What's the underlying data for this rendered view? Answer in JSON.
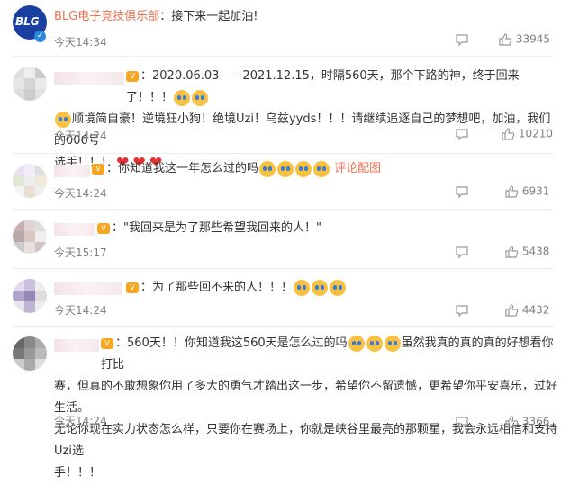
{
  "comments": [
    {
      "name": "BLG电子竞技俱乐部",
      "text": "：接下来一起加油!",
      "time": "今天14:34",
      "likes": "33945"
    },
    {
      "line1": "：2020.06.03——2021.12.15，时隔560天，那个下路的神，终于回来了！！！",
      "line2": "顺境简自豪！逆境狂小狗！绝境Uzi！乌兹yyds！！！请继续追逐自己的梦想吧，加油，我们的006号",
      "line3": "选手！！！",
      "time": "今天14:24",
      "likes": "10210"
    },
    {
      "text": "：你知道我这一年怎么过的吗",
      "link": "评论配图",
      "time": "今天14:24",
      "likes": "6931"
    },
    {
      "text": "：\"我回来是为了那些希望我回来的人！\"",
      "time": "今天15:17",
      "likes": "5438"
    },
    {
      "text": "：为了那些回不来的人！！！",
      "time": "今天14:24",
      "likes": "4432"
    },
    {
      "line1a": "：560天！！你知道我这560天是怎么过的吗",
      "line1b": "虽然我真的真的真的好想看你打比",
      "line2": "赛，但真的不敢想象你用了多大的勇气才踏出这一步，希望你不留遗憾，更希望你平安喜乐，过好生活。",
      "line3": "无论你现在实力状态怎么样，只要你在赛场上，你就是峡谷里最亮的那颗星，我会永远相信和支持Uzi选",
      "line4": "手！！！",
      "time": "今天14:24",
      "likes": "3366"
    }
  ],
  "logo": "BLG",
  "accent": "#eb7350"
}
